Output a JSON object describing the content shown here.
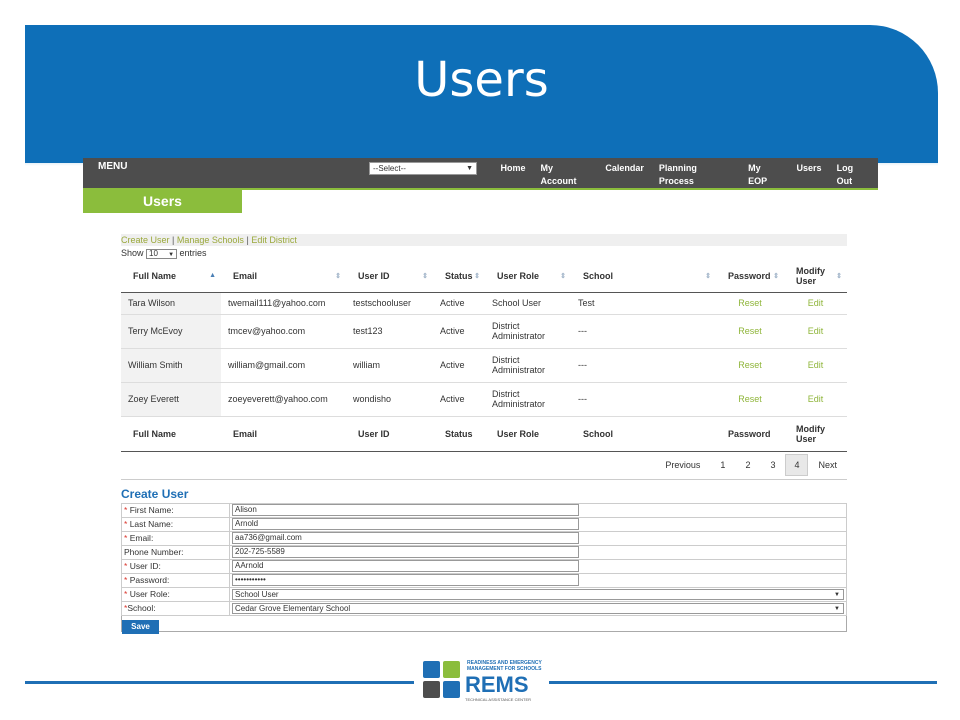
{
  "slide": {
    "title": "Users"
  },
  "menubar": {
    "menu_label": "MENU",
    "select_value": "--Select--",
    "links": [
      "Home",
      "My Account",
      "Calendar",
      "Planning Process",
      "My EOP",
      "Users",
      "Log Out"
    ]
  },
  "page_tab": "Users",
  "action_links": {
    "create_user": "Create User",
    "manage_schools": "Manage Schools",
    "edit_district": "Edit District",
    "sep": "|"
  },
  "show_entries": {
    "show": "Show",
    "value": "10",
    "entries": "entries"
  },
  "table": {
    "headers": [
      "Full Name",
      "Email",
      "User ID",
      "Status",
      "User Role",
      "School",
      "Password",
      "Modify User"
    ],
    "rows": [
      {
        "name": "Tara Wilson",
        "email": "twemail111@yahoo.com",
        "uid": "testschooluser",
        "status": "Active",
        "role": "School User",
        "school": "Test",
        "password": "Reset",
        "modify": "Edit"
      },
      {
        "name": "Terry McEvoy",
        "email": "tmcev@yahoo.com",
        "uid": "test123",
        "status": "Active",
        "role": "District Administrator",
        "school": "---",
        "password": "Reset",
        "modify": "Edit"
      },
      {
        "name": "William Smith",
        "email": "william@gmail.com",
        "uid": "william",
        "status": "Active",
        "role": "District Administrator",
        "school": "---",
        "password": "Reset",
        "modify": "Edit"
      },
      {
        "name": "Zoey Everett",
        "email": "zoeyeverett@yahoo.com",
        "uid": "wondisho",
        "status": "Active",
        "role": "District Administrator",
        "school": "---",
        "password": "Reset",
        "modify": "Edit"
      }
    ]
  },
  "pager": {
    "previous": "Previous",
    "pages": [
      "1",
      "2",
      "3",
      "4"
    ],
    "current": "4",
    "next": "Next"
  },
  "create_form": {
    "title": "Create User",
    "fields": [
      {
        "label": "First Name:",
        "required": true,
        "value": "Alison"
      },
      {
        "label": "Last Name:",
        "required": true,
        "value": "Arnold"
      },
      {
        "label": "Email:",
        "required": true,
        "value": "aa736@gmail.com"
      },
      {
        "label": "Phone Number:",
        "required": false,
        "value": "202-725-5589"
      },
      {
        "label": "User ID:",
        "required": true,
        "value": "AArnold"
      },
      {
        "label": "Password:",
        "required": true,
        "value": "•••••••••••"
      }
    ],
    "user_role": {
      "label": "User Role:",
      "required": true,
      "value": "School User"
    },
    "school": {
      "label": "School:",
      "required": true,
      "value": "Cedar Grove Elementary School"
    },
    "save_label": "Save",
    "required_mark": "*"
  },
  "footer": {
    "logo_text": "REMS",
    "logo_tagline": "READINESS AND EMERGENCY MANAGEMENT FOR SCHOOLS",
    "logo_sub": "TECHNICAL ASSISTANCE CENTER"
  }
}
